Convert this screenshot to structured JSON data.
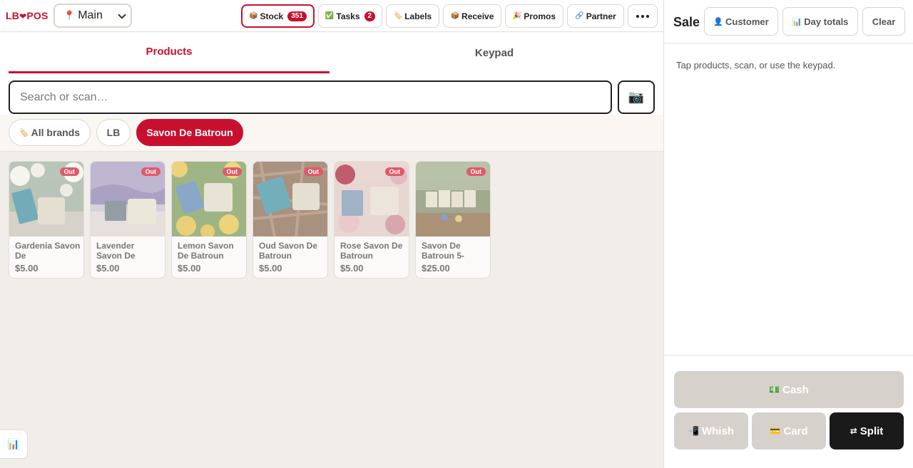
{
  "header": {
    "logo_left": "LB",
    "logo_heart": "❤",
    "logo_right": "POS",
    "location": "Main",
    "buttons": [
      {
        "icon": "📦",
        "label": "Stock",
        "badge": "351"
      },
      {
        "icon": "✅",
        "label": "Tasks",
        "badge": "2"
      },
      {
        "icon": "🏷️",
        "label": "Labels"
      },
      {
        "icon": "📦",
        "label": "Receive"
      },
      {
        "icon": "🎉",
        "label": "Promos"
      },
      {
        "icon": "🔗",
        "label": "Partner"
      }
    ]
  },
  "tabs": {
    "products": "Products",
    "keypad": "Keypad"
  },
  "search": {
    "placeholder": "Search or scan…"
  },
  "camera_icon": "📷",
  "brands": [
    {
      "icon": "🏷️",
      "label": "All brands"
    },
    {
      "label": "LB"
    },
    {
      "label": "Savon De Batroun",
      "selected": true
    }
  ],
  "products": [
    {
      "name": "Gardenia Savon De",
      "price": "$5.00",
      "status": "Out"
    },
    {
      "name": "Lavender Savon De",
      "price": "$5.00",
      "status": "Out"
    },
    {
      "name": "Lemon Savon De Batroun",
      "price": "$5.00",
      "status": "Out"
    },
    {
      "name": "Oud Savon De Batroun",
      "price": "$5.00",
      "status": "Out"
    },
    {
      "name": "Rose Savon De Batroun",
      "price": "$5.00",
      "status": "Out"
    },
    {
      "name": "Savon De Batroun 5-",
      "price": "$25.00",
      "status": "Out"
    }
  ],
  "stats_icon": "📊",
  "sale": {
    "title": "Sale",
    "customer": {
      "icon": "👤",
      "label": "Customer"
    },
    "day_totals": {
      "icon": "📊",
      "label": "Day totals"
    },
    "clear": "Clear",
    "empty_text": "Tap products, scan, or use the keypad."
  },
  "payment": {
    "cash": {
      "icon": "💵",
      "label": "Cash"
    },
    "whish": {
      "icon": "📲",
      "label": "Whish"
    },
    "card": {
      "icon": "💳",
      "label": "Card"
    },
    "split": {
      "icon": "⇄",
      "label": "Split"
    }
  },
  "colors": {
    "accent": "#c8102e",
    "background": "#f1eee9",
    "disabled": "#d6d1cb",
    "dark": "#1a1a1a"
  }
}
